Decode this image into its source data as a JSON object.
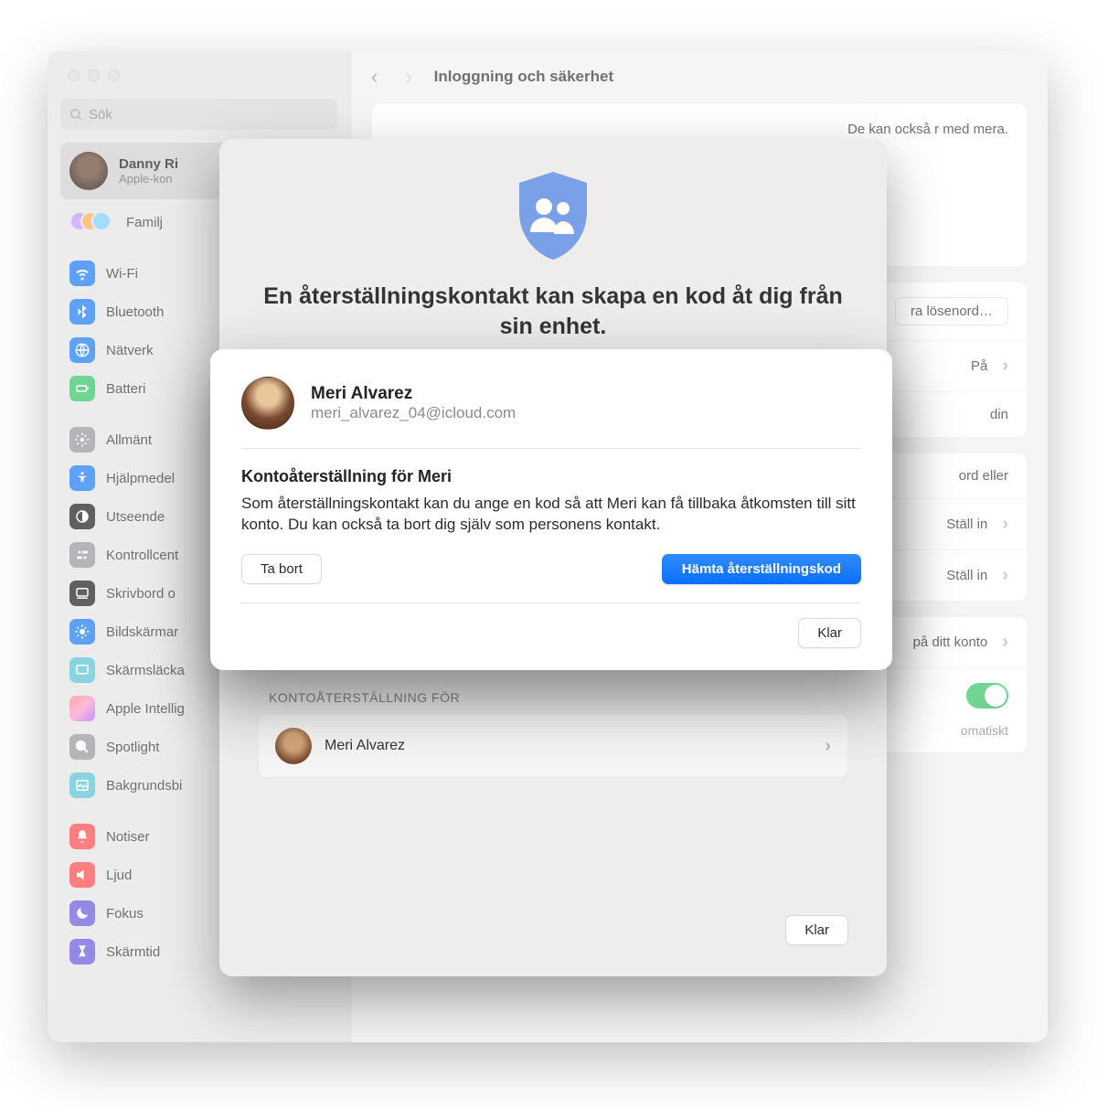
{
  "search": {
    "placeholder": "Sök"
  },
  "account": {
    "name": "Danny Ri",
    "sub": "Apple-kon"
  },
  "sidebar": {
    "familj": "Familj",
    "wifi": "Wi-Fi",
    "bluetooth": "Bluetooth",
    "network": "Nätverk",
    "battery": "Batteri",
    "general": "Allmänt",
    "accessibility": "Hjälpmedel",
    "appearance": "Utseende",
    "controlcenter": "Kontrollcent",
    "desktop": "Skrivbord o",
    "displays": "Bildskärmar",
    "screensaver": "Skärmsläcka",
    "ai": "Apple Intellig",
    "spotlight": "Spotlight",
    "wallpaper": "Bakgrundsbi",
    "notifications": "Notiser",
    "sound": "Ljud",
    "focus": "Fokus",
    "screentime": "Skärmtid"
  },
  "header": {
    "title": "Inloggning och säkerhet"
  },
  "main": {
    "desc_right": "De kan också r med mera.",
    "change_password": "ra lösenord…",
    "on": "På",
    "din": "din",
    "ord_eller": "ord eller",
    "stall_in": "Ställ in",
    "pa_konto": "på ditt konto",
    "automatiskt": "omatiskt"
  },
  "sheet": {
    "title": "En återställningskontakt kan skapa en kod åt dig från sin enhet.",
    "section": "KONTOÅTERSTÄLLNING FÖR",
    "contact_name": "Meri Alvarez",
    "done": "Klar"
  },
  "dialog": {
    "name": "Meri Alvarez",
    "email": "meri_alvarez_04@icloud.com",
    "subtitle": "Kontoåterställning för Meri",
    "body": "Som återställningskontakt kan du ange en kod så att Meri kan få tillbaka åtkomsten till sitt konto. Du kan också ta bort dig själv som personens kontakt.",
    "remove": "Ta bort",
    "get_code": "Hämta återställningskod",
    "done": "Klar"
  }
}
